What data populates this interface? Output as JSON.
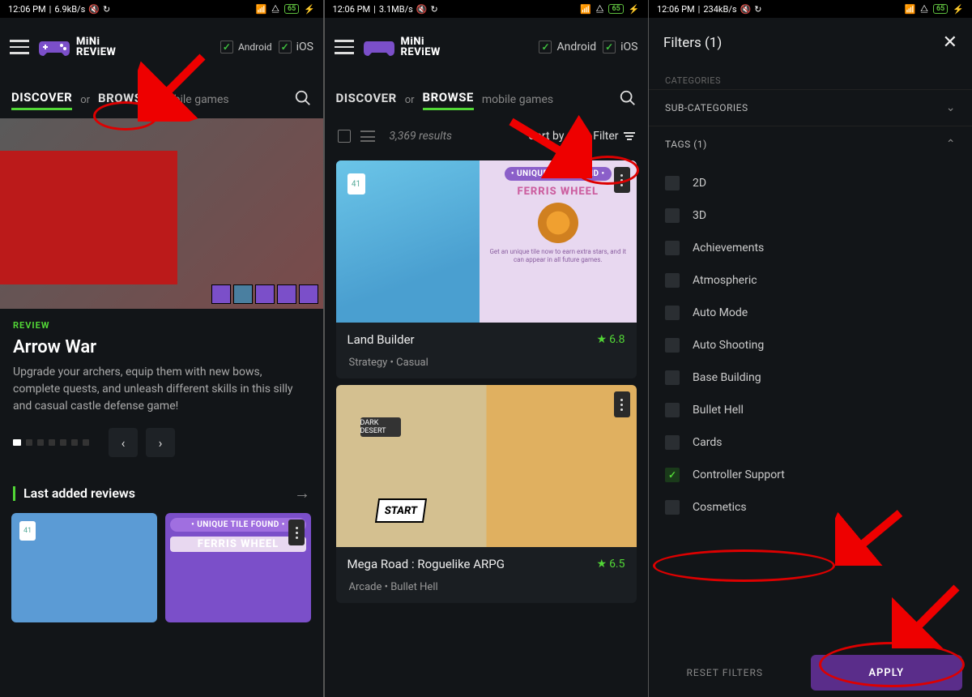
{
  "status": {
    "time": "12:06 PM",
    "net1": "6.9kB/s",
    "net2": "3.1MB/s",
    "net3": "234kB/s",
    "battery": "65"
  },
  "app": {
    "logo_text_1": "MiNi",
    "logo_text_2": "REViEW",
    "platform_android": "Android",
    "platform_ios": "iOS"
  },
  "nav": {
    "discover": "DISCOVER",
    "or": "or",
    "browse": "BROWSE",
    "sub": "mobile games"
  },
  "panel1": {
    "review_tag": "REVIEW",
    "title": "Arrow War",
    "desc": "Upgrade your archers, equip them with new bows, complete quests, and unleash different skills in this silly and casual castle defense game!",
    "section_title": "Last added reviews",
    "tile_badge": "• UNIQUE TILE FOUND •",
    "tile_label": "FERRIS WHEEL"
  },
  "panel2": {
    "results": "3,369 results",
    "sort_by": "Sort by",
    "filter": "Filter",
    "game1": {
      "name": "Land Builder",
      "rating": "6.8",
      "tags": "Strategy  •  Casual",
      "tile_badge": "• UNIQUE TILE FOUND •",
      "tile_label": "FERRIS WHEEL",
      "tile_sub": "Get an unique tile now to earn extra stars, and it can appear in all future games."
    },
    "game2": {
      "name": "Mega Road : Roguelike ARPG",
      "rating": "6.5",
      "tags": "Arcade  •  Bullet Hell"
    }
  },
  "panel3": {
    "title": "Filters (1)",
    "categories": "CATEGORIES",
    "subcategories": "SUB-CATEGORIES",
    "tags_header": "TAGS (1)",
    "tags": [
      "2D",
      "3D",
      "Achievements",
      "Atmospheric",
      "Auto Mode",
      "Auto Shooting",
      "Base Building",
      "Bullet Hell",
      "Cards",
      "Controller Support",
      "Cosmetics"
    ],
    "checked_tag": "Controller Support",
    "reset": "RESET FILTERS",
    "apply": "APPLY"
  }
}
